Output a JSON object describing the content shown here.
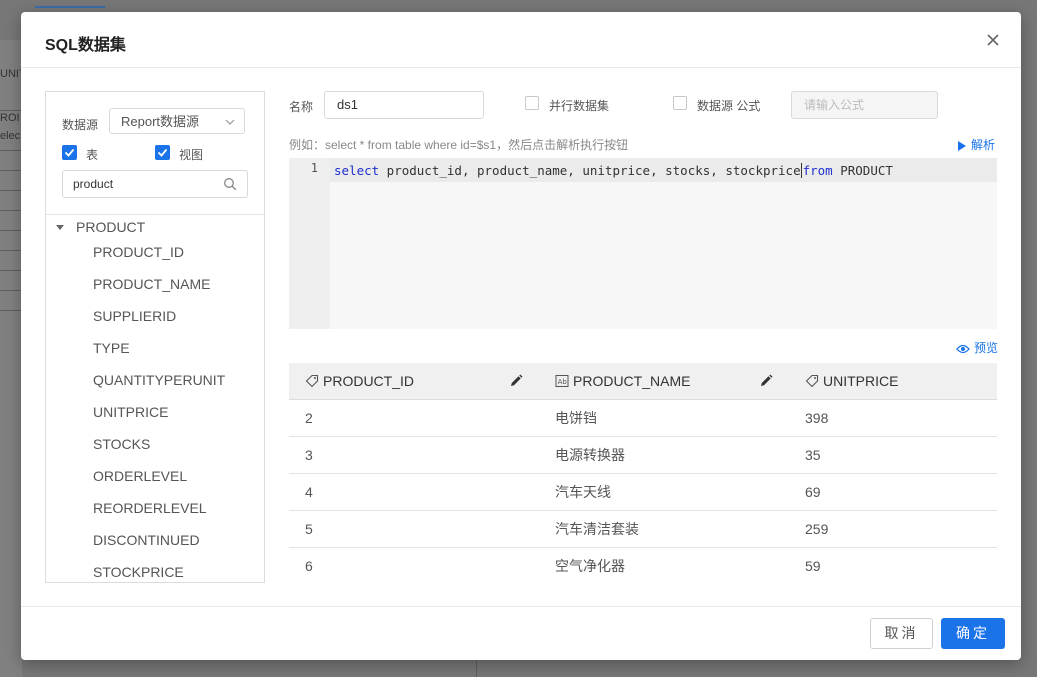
{
  "background": {
    "left_fragments": [
      "UNIT",
      "ROI",
      "elec",
      "PRO"
    ]
  },
  "dialog": {
    "title": "SQL数据集",
    "close_label": "×"
  },
  "left_panel": {
    "datasource_label": "数据源",
    "datasource_value": "Report数据源",
    "table_checkbox": {
      "label": "表",
      "checked": true
    },
    "view_checkbox": {
      "label": "视图",
      "checked": true
    },
    "search_value": "product",
    "tree": {
      "root": "PRODUCT",
      "fields": [
        "PRODUCT_ID",
        "PRODUCT_NAME",
        "SUPPLIERID",
        "TYPE",
        "QUANTITYPERUNIT",
        "UNITPRICE",
        "STOCKS",
        "ORDERLEVEL",
        "REORDERLEVEL",
        "DISCONTINUED",
        "STOCKPRICE"
      ]
    }
  },
  "form": {
    "name_label": "名称",
    "name_value": "ds1",
    "parallel_label": "并行数据集",
    "ds_formula_label": "数据源 公式",
    "formula_placeholder": "请输入公式",
    "hint": "例如：select * from table where id=$s1，然后点击解析执行按钮",
    "parse_label": "解析",
    "preview_label": "预览"
  },
  "editor": {
    "line_number": "1",
    "kw_select": "select",
    "code_middle": " product_id, product_name, unitprice, stocks, stockprice",
    "kw_from": "from",
    "code_end": " PRODUCT"
  },
  "preview_table": {
    "columns": [
      {
        "name": "PRODUCT_ID",
        "type_icon": "number-tag-icon",
        "editable": true
      },
      {
        "name": "PRODUCT_NAME",
        "type_icon": "text-type-icon",
        "editable": true
      },
      {
        "name": "UNITPRICE",
        "type_icon": "number-tag-icon",
        "editable": false
      }
    ],
    "rows": [
      [
        "2",
        "电饼铛",
        "398"
      ],
      [
        "3",
        "电源转换器",
        "35"
      ],
      [
        "4",
        "汽车天线",
        "69"
      ],
      [
        "5",
        "汽车清洁套装",
        "259"
      ],
      [
        "6",
        "空气净化器",
        "59"
      ]
    ]
  },
  "footer": {
    "cancel_label": "取消",
    "ok_label": "确定"
  },
  "colors": {
    "accent": "#1a73e8",
    "keyword": "#1f2fd0",
    "overlay": "#6b6b6b"
  }
}
